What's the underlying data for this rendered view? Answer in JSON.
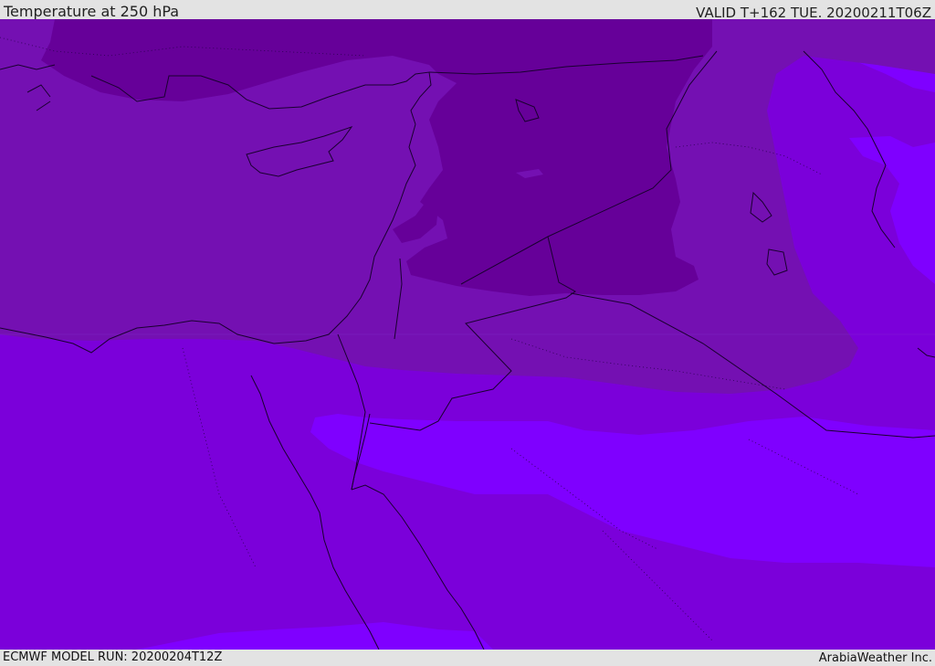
{
  "header": {
    "title": "Temperature at 250 hPa",
    "valid": "VALID T+162 TUE. 20200211T06Z"
  },
  "footer": {
    "model_run": "ECMWF MODEL RUN: 20200204T12Z",
    "credit": "ArabiaWeather Inc."
  },
  "map": {
    "colors": {
      "darkest_band": "#660099",
      "dark_band": "#7410b2",
      "mid_band": "#7b00da",
      "light_band": "#7f00ff",
      "border_line": "#1a0030"
    }
  }
}
